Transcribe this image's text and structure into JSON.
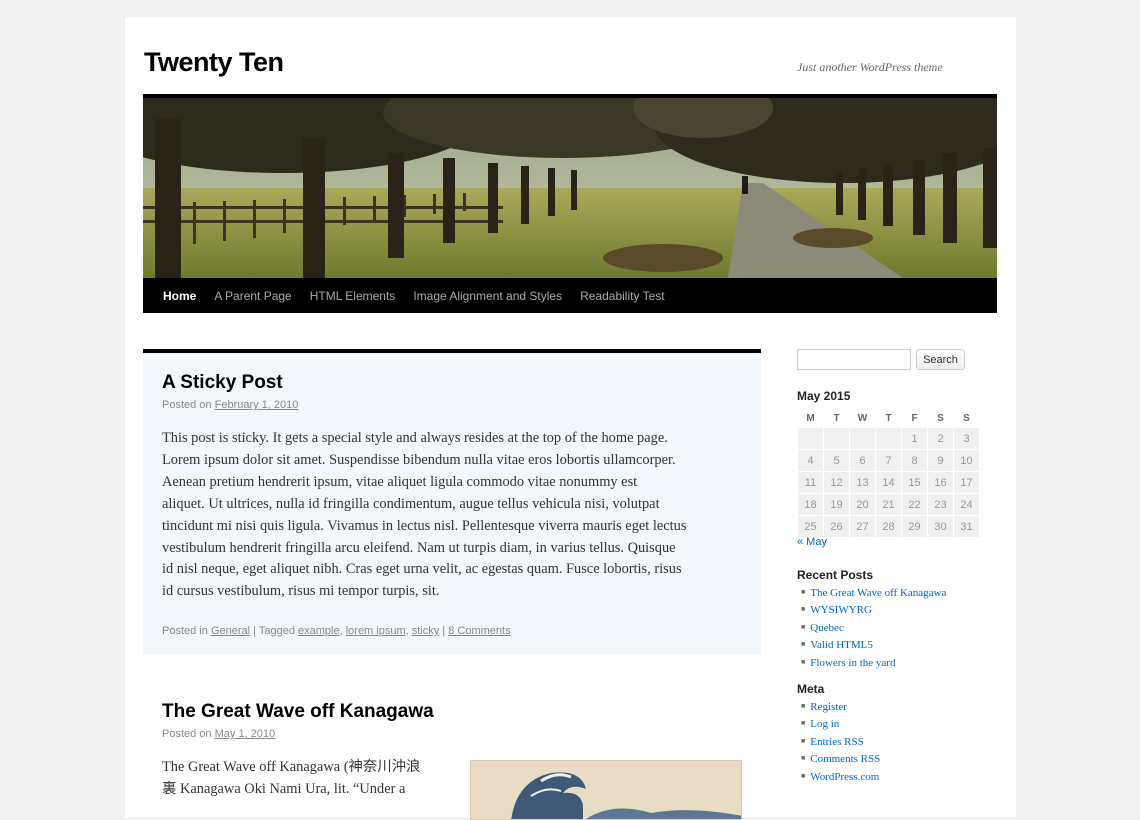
{
  "site": {
    "title": "Twenty Ten",
    "description": "Just another WordPress theme"
  },
  "nav": {
    "items": [
      "Home",
      "A Parent Page",
      "HTML Elements",
      "Image Alignment and Styles",
      "Readability Test"
    ],
    "current": "Home"
  },
  "sticky_post": {
    "title": "A Sticky Post",
    "posted_on_label": "Posted on",
    "date": "February 1, 2010",
    "body_lines": [
      "This post is sticky. It gets a special style and always resides at the top of the home page.",
      "Lorem ipsum dolor sit amet. Suspendisse bibendum nulla vitae eros lobortis ullamcorper.",
      "Aenean pretium hendrerit ipsum, vitae aliquet ligula commodo vitae nonummy est",
      "aliquet. Ut ultrices, nulla id fringilla condimentum, augue tellus vehicula nisi, volutpat",
      "tincidunt mi nisi quis ligula. Vivamus in lectus nisl. Pellentesque viverra mauris eget lectus",
      "vestibulum hendrerit fringilla arcu eleifend. Nam ut turpis diam, in varius tellus. Quisque",
      "id nisl neque, eget aliquet nibh. Cras eget urna velit, ac egestas quam. Fusce lobortis, risus",
      "id cursus vestibulum, risus mi tempor turpis, sit."
    ],
    "posted_in_label": "Posted in",
    "category": "General",
    "tagged_label": "Tagged",
    "tags": [
      "example",
      "lorem ipsum",
      "sticky"
    ],
    "comments": "8 Comments"
  },
  "post2": {
    "title": "The Great Wave off Kanagawa",
    "posted_on_label": "Posted on",
    "date": "May 1, 2010",
    "body_lines": [
      "The Great Wave off Kanagawa (神奈川沖浪",
      "裏 Kanagawa Oki Nami Ura, lit. “Under a"
    ]
  },
  "sidebar": {
    "search_button": "Search",
    "search_value": "",
    "calendar": {
      "caption": "May 2015",
      "days": [
        "M",
        "T",
        "W",
        "T",
        "F",
        "S",
        "S"
      ],
      "weeks": [
        [
          "",
          "",
          "",
          "",
          "1",
          "2",
          "3"
        ],
        [
          "4",
          "5",
          "6",
          "7",
          "8",
          "9",
          "10"
        ],
        [
          "11",
          "12",
          "13",
          "14",
          "15",
          "16",
          "17"
        ],
        [
          "18",
          "19",
          "20",
          "21",
          "22",
          "23",
          "24"
        ],
        [
          "25",
          "26",
          "27",
          "28",
          "29",
          "30",
          "31"
        ]
      ],
      "prev": "« May"
    },
    "recent_posts": {
      "title": "Recent Posts",
      "items": [
        "The Great Wave off Kanagawa",
        "WYSIWYRG",
        "Quebec",
        "Valid HTML5",
        "Flowers in the yard"
      ]
    },
    "meta": {
      "title": "Meta",
      "items": [
        "Register",
        "Log in",
        "Entries RSS",
        "Comments RSS",
        "WordPress.com"
      ]
    }
  }
}
